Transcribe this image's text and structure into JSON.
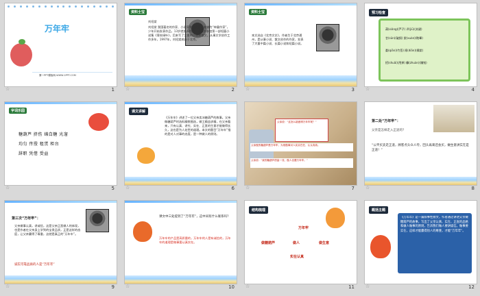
{
  "slides": [
    {
      "num": "1",
      "title": "万年牢",
      "footer": "第一PPT模板网-WWW.1PPT.COM"
    },
    {
      "num": "2",
      "tag": "资料士宝",
      "name": "刘绍棠",
      "text": "刘绍棠 我国著名的作家、小说家和散文家。被誉为“神童作家”，少年开始发表作品，13岁就发表作品，十四岁参加第一部短篇小说集《青枝绿叶》，后来写了大量的小说和散文。从事文学创作工作多年，1997年，刘绍棠病逝于北京。"
    },
    {
      "num": "3",
      "tag": "资料士宝",
      "text": "本文选自《北京文艺》，作者生于北京通州，是从事小说、散文创作的作家，发表了大量中篇小说、长篇小说和短篇小说。"
    },
    {
      "num": "4",
      "tag": "预习检查",
      "rows": [
        "葫(xiáng)(芦子) 评(jiū)(关键)",
        "甘(sǔn)(破损) 棠(xuàn)(眩晕)",
        "委(qiān)(竹签) 裱(diān)(摘棠)",
        "招(shuǎi)(甩掉) 糠(zhuàn)(赚钱)"
      ]
    },
    {
      "num": "5",
      "tag": "字词乐园",
      "rows": [
        "糖葫芦 挤伤 绵白糖 光溜",
        "均匀 传授 租赁 柜台",
        "辞职 凭借 受益"
      ]
    },
    {
      "num": "6",
      "tag": "课文讲解",
      "text": "《万年牢》讲述了一位父亲卖冰糖葫芦的故事。父亲做糖葫芦时选料精挑细选，做工精益求精，在父亲看来，只有认真、讲究、实在、正直的生意才能做得长久，这也是为人处世的道理。本文的题目“万年牢”指的是对人对事的态度，是一种做人的原则。"
    },
    {
      "num": "7",
      "text1": "父亲说：“这怎么能做得万年牢呢？”",
      "text2": "父亲做的糖葫芦是万年牢，为他做事对人实实在在、认认真真。",
      "text3": "父亲说：“我的糖葫芦质量一流，做人也要万年牢。”"
    },
    {
      "num": "8",
      "heading": "第二处“万年牢”：",
      "q": "父亲是怎样走入正途的？",
      "text": "“公平买卖走正道，顾客点头众人夸，回头再来还会买，做生意讲实在是正道！”"
    },
    {
      "num": "9",
      "heading": "第三次“万年牢”：",
      "text": "父亲做事认真，讲诚信，这是父亲正直做人的体现，也是作者在父亲身上学到的宝贵品质，正是这样的态度，让父亲赢得了尊重，这就是真正的“万年牢”。",
      "foot": "诚实可靠品质的人是“万年牢”"
    },
    {
      "num": "10",
      "text": "课文中三处提到了“万年牢”，这中间有什么联系吗？",
      "text2": "万年牢的产品是高质量的，万年牢的人是有诚信的，万年牢的道理是做事要认真实在。"
    },
    {
      "num": "11",
      "tag": "结构梳理",
      "center": "万年牢",
      "left": "做糖葫芦",
      "mid": "做人",
      "right": "做生意",
      "bottom": "实在认真"
    },
    {
      "num": "12",
      "tag": "概括主题",
      "text": "《万年牢》是一篇叙事性散文，作者通过讲述父亲做糖葫芦的故事，写出了父亲认真、实在、正直的品格和做人做事的原则，告诉我们做人要讲诚信，做事要实在，这样才能赢得别人的尊重，才能“万年牢”。"
    }
  ]
}
